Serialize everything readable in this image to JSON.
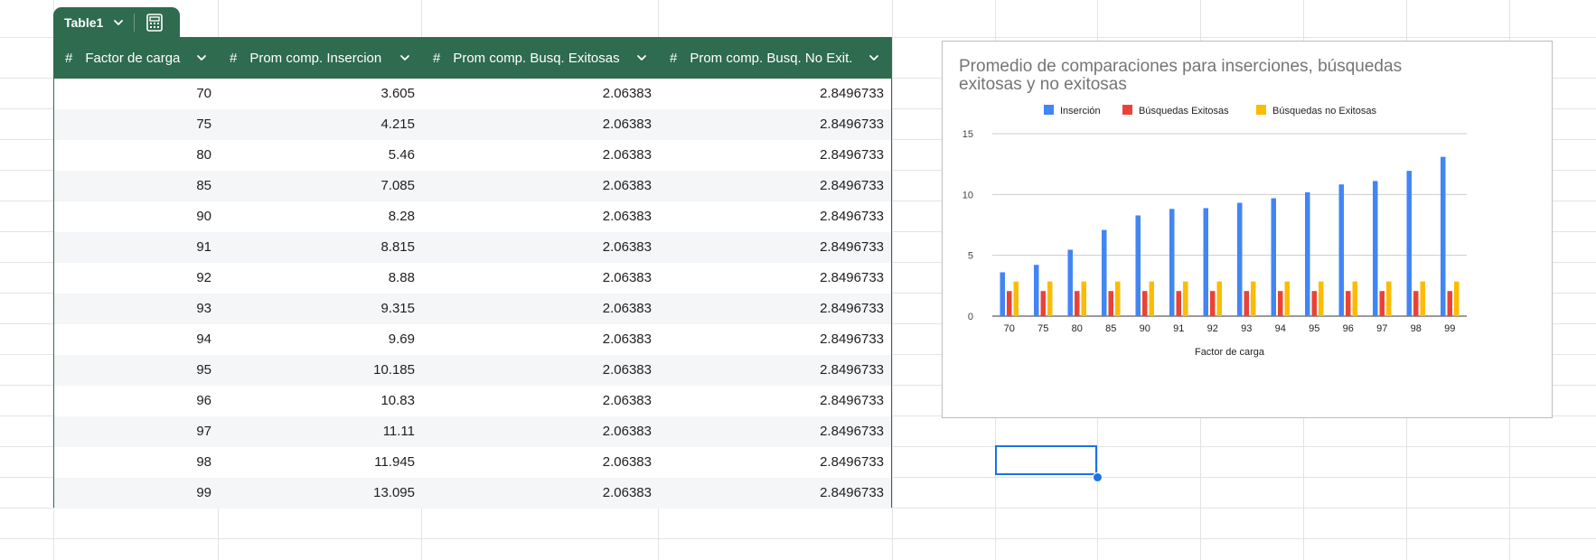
{
  "table": {
    "name": "Table1",
    "hash_symbol": "#",
    "columns": [
      "Factor de carga",
      "Prom comp. Insercion",
      "Prom comp. Busq. Exitosas",
      "Prom comp. Busq. No Exit."
    ],
    "rows": [
      [
        "70",
        "3.605",
        "2.06383",
        "2.8496733"
      ],
      [
        "75",
        "4.215",
        "2.06383",
        "2.8496733"
      ],
      [
        "80",
        "5.46",
        "2.06383",
        "2.8496733"
      ],
      [
        "85",
        "7.085",
        "2.06383",
        "2.8496733"
      ],
      [
        "90",
        "8.28",
        "2.06383",
        "2.8496733"
      ],
      [
        "91",
        "8.815",
        "2.06383",
        "2.8496733"
      ],
      [
        "92",
        "8.88",
        "2.06383",
        "2.8496733"
      ],
      [
        "93",
        "9.315",
        "2.06383",
        "2.8496733"
      ],
      [
        "94",
        "9.69",
        "2.06383",
        "2.8496733"
      ],
      [
        "95",
        "10.185",
        "2.06383",
        "2.8496733"
      ],
      [
        "96",
        "10.83",
        "2.06383",
        "2.8496733"
      ],
      [
        "97",
        "11.11",
        "2.06383",
        "2.8496733"
      ],
      [
        "98",
        "11.945",
        "2.06383",
        "2.8496733"
      ],
      [
        "99",
        "13.095",
        "2.06383",
        "2.8496733"
      ]
    ]
  },
  "colors": {
    "table_header": "#2e6b4f",
    "series_insercion": "#4285f4",
    "series_exitosas": "#ea4335",
    "series_no_exitosas": "#fbbc04",
    "selection": "#1a73e8"
  },
  "icons": {
    "tab_dropdown": "chevron-down-icon",
    "tab_summary": "calculator-icon",
    "column_type": "hash-icon",
    "column_menu": "chevron-down-icon"
  },
  "chart_data": {
    "type": "bar",
    "title": "Promedio de comparaciones para inserciones, búsquedas exitosas y no exitosas",
    "xlabel": "Factor de carga",
    "ylabel": "",
    "ylim": [
      0,
      15
    ],
    "yticks": [
      0,
      5,
      10,
      15
    ],
    "grid": true,
    "legend": "top",
    "categories": [
      "70",
      "75",
      "80",
      "85",
      "90",
      "91",
      "92",
      "93",
      "94",
      "95",
      "96",
      "97",
      "98",
      "99"
    ],
    "series": [
      {
        "name": "Inserción",
        "color": "#4285f4",
        "values": [
          3.605,
          4.215,
          5.46,
          7.085,
          8.28,
          8.815,
          8.88,
          9.315,
          9.69,
          10.185,
          10.83,
          11.11,
          11.945,
          13.095
        ]
      },
      {
        "name": "Búsquedas Exitosas",
        "color": "#ea4335",
        "values": [
          2.06383,
          2.06383,
          2.06383,
          2.06383,
          2.06383,
          2.06383,
          2.06383,
          2.06383,
          2.06383,
          2.06383,
          2.06383,
          2.06383,
          2.06383,
          2.06383
        ]
      },
      {
        "name": "Búsquedas no Exitosas",
        "color": "#fbbc04",
        "values": [
          2.8496733,
          2.8496733,
          2.8496733,
          2.8496733,
          2.8496733,
          2.8496733,
          2.8496733,
          2.8496733,
          2.8496733,
          2.8496733,
          2.8496733,
          2.8496733,
          2.8496733,
          2.8496733
        ]
      }
    ]
  }
}
